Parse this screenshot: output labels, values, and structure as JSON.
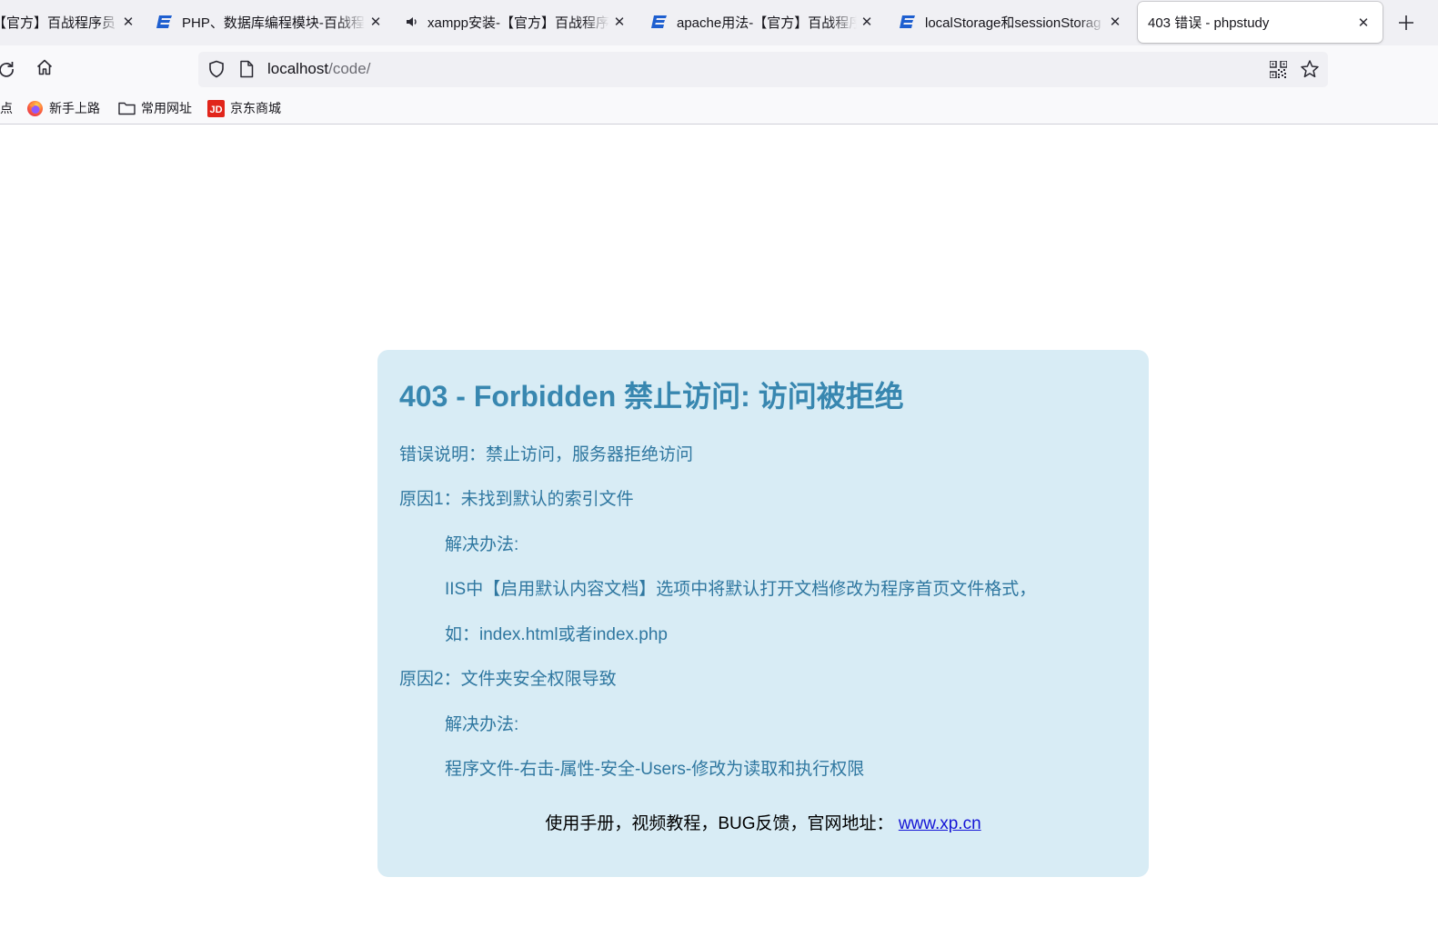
{
  "tabs": [
    {
      "title": "【官方】百战程序员",
      "icon": "bz-logo-icon",
      "active": false
    },
    {
      "title": "PHP、数据库编程模块-百战程",
      "icon": "bz-logo-icon",
      "active": false
    },
    {
      "title": "xampp安装-【官方】百战程序",
      "icon": "speaker-icon",
      "active": false
    },
    {
      "title": "apache用法-【官方】百战程序",
      "icon": "bz-logo-icon",
      "active": false
    },
    {
      "title": "localStorage和sessionStorag",
      "icon": "bz-logo-icon",
      "active": false
    },
    {
      "title": "403 错误 - phpstudy",
      "icon": "",
      "active": true
    }
  ],
  "urlbar": {
    "host": "localhost",
    "path": "/code/"
  },
  "bookmarks": [
    {
      "label": "点",
      "icon": ""
    },
    {
      "label": "新手上路",
      "icon": "firefox-icon"
    },
    {
      "label": "常用网址",
      "icon": "folder-icon"
    },
    {
      "label": "京东商城",
      "icon": "jd-logo-icon"
    }
  ],
  "page": {
    "title": "403 - Forbidden 禁止访问: 访问被拒绝",
    "lines": [
      "错误说明：禁止访问，服务器拒绝访问",
      "原因1：未找到默认的索引文件",
      "解决办法:",
      "IIS中【启用默认内容文档】选项中将默认打开文档修改为程序首页文件格式，",
      "如：index.html或者index.php",
      "原因2：文件夹安全权限导致",
      "解决办法:",
      "程序文件-右击-属性-安全-Users-修改为读取和执行权限"
    ],
    "footer_text": "使用手册，视频教程，BUG反馈，官网地址：",
    "footer_link": "www.xp.cn"
  },
  "colors": {
    "card_bg": "#d8ecf5",
    "title": "#3887b0",
    "text": "#2f77a0",
    "link": "#1515d6"
  }
}
